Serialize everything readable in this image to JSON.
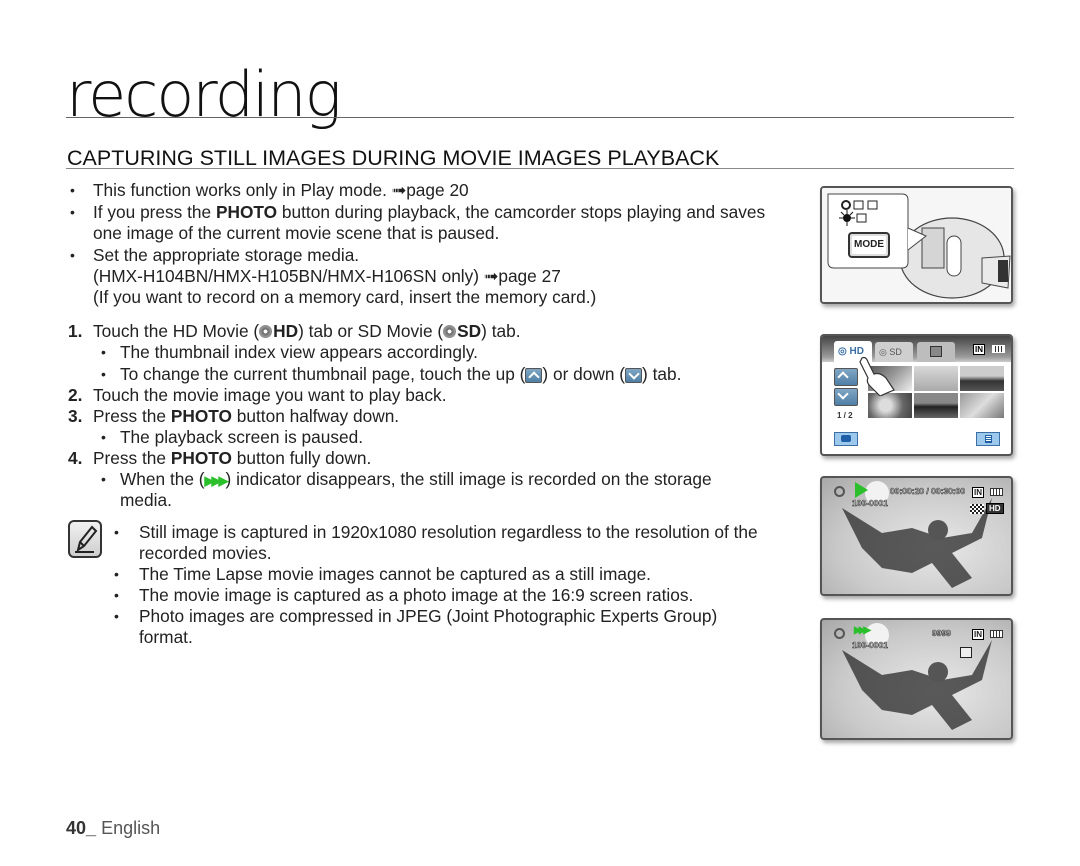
{
  "chapter": {
    "title": "recording"
  },
  "section": {
    "title": "CAPTURING STILL IMAGES DURING MOVIE IMAGES PLAYBACK"
  },
  "intro_bullets": [
    {
      "pre": "This function works only in Play mode. ",
      "ref": "➟page 20"
    },
    {
      "pre": "If you press the ",
      "bold": "PHOTO",
      "post": " button during playback, the camcorder stops playing and saves",
      "line2": "one image of the current movie scene that is paused."
    },
    {
      "pre": "Set the appropriate storage media.",
      "line2": "(HMX-H104BN/HMX-H105BN/HMX-H106SN only) ",
      "ref": "➟page 27",
      "line3": "(If you want to record on a memory card, insert the memory card.)"
    }
  ],
  "steps": [
    {
      "num": "1.",
      "pre": "Touch the HD Movie (",
      "hd": "HD",
      "mid": ") tab or SD Movie (",
      "sd": "SD",
      "post": ") tab.",
      "subs": [
        {
          "text": "The thumbnail index view appears accordingly."
        },
        {
          "pre": "To change the current thumbnail page, touch the up (",
          "mid": ") or down (",
          "post": ") tab."
        }
      ]
    },
    {
      "num": "2.",
      "text": "Touch the movie image you want to play back."
    },
    {
      "num": "3.",
      "pre": "Press the ",
      "bold": "PHOTO",
      "post": " button halfway down.",
      "subs": [
        {
          "text": "The playback screen is paused."
        }
      ]
    },
    {
      "num": "4.",
      "pre": "Press the ",
      "bold": "PHOTO",
      "post": " button fully down.",
      "subs": [
        {
          "pre": "When the (",
          "post": ") indicator disappears, the still image is recorded on the storage",
          "line2": "media."
        }
      ]
    }
  ],
  "notes": [
    {
      "text": "Still image is captured in 1920x1080 resolution regardless to the resolution of the",
      "line2": "recorded movies."
    },
    {
      "text": "The Time Lapse movie images cannot be captured as a still image."
    },
    {
      "text": "The movie image is captured as a photo image at the 16:9 screen ratios."
    },
    {
      "text": "Photo images are compressed in JPEG (Joint Photographic Experts Group)",
      "line2": "format."
    }
  ],
  "panels": {
    "mode": {
      "button_label": "MODE"
    },
    "thumbnail": {
      "tab_hd": "HD",
      "tab_sd": "SD",
      "page": "1 / 2",
      "storage": "IN"
    },
    "playback": {
      "time": "00:00:20 / 00:30:00",
      "file": "100-0001",
      "storage": "IN",
      "quality": "HD"
    },
    "capture": {
      "count": "9999",
      "file": "100-0001",
      "storage": "IN"
    }
  },
  "colors": {
    "play_green": "#2bc02b",
    "ui_blue": "#5b8bb3"
  },
  "footer": {
    "page_number": "40_",
    "language": "English"
  }
}
